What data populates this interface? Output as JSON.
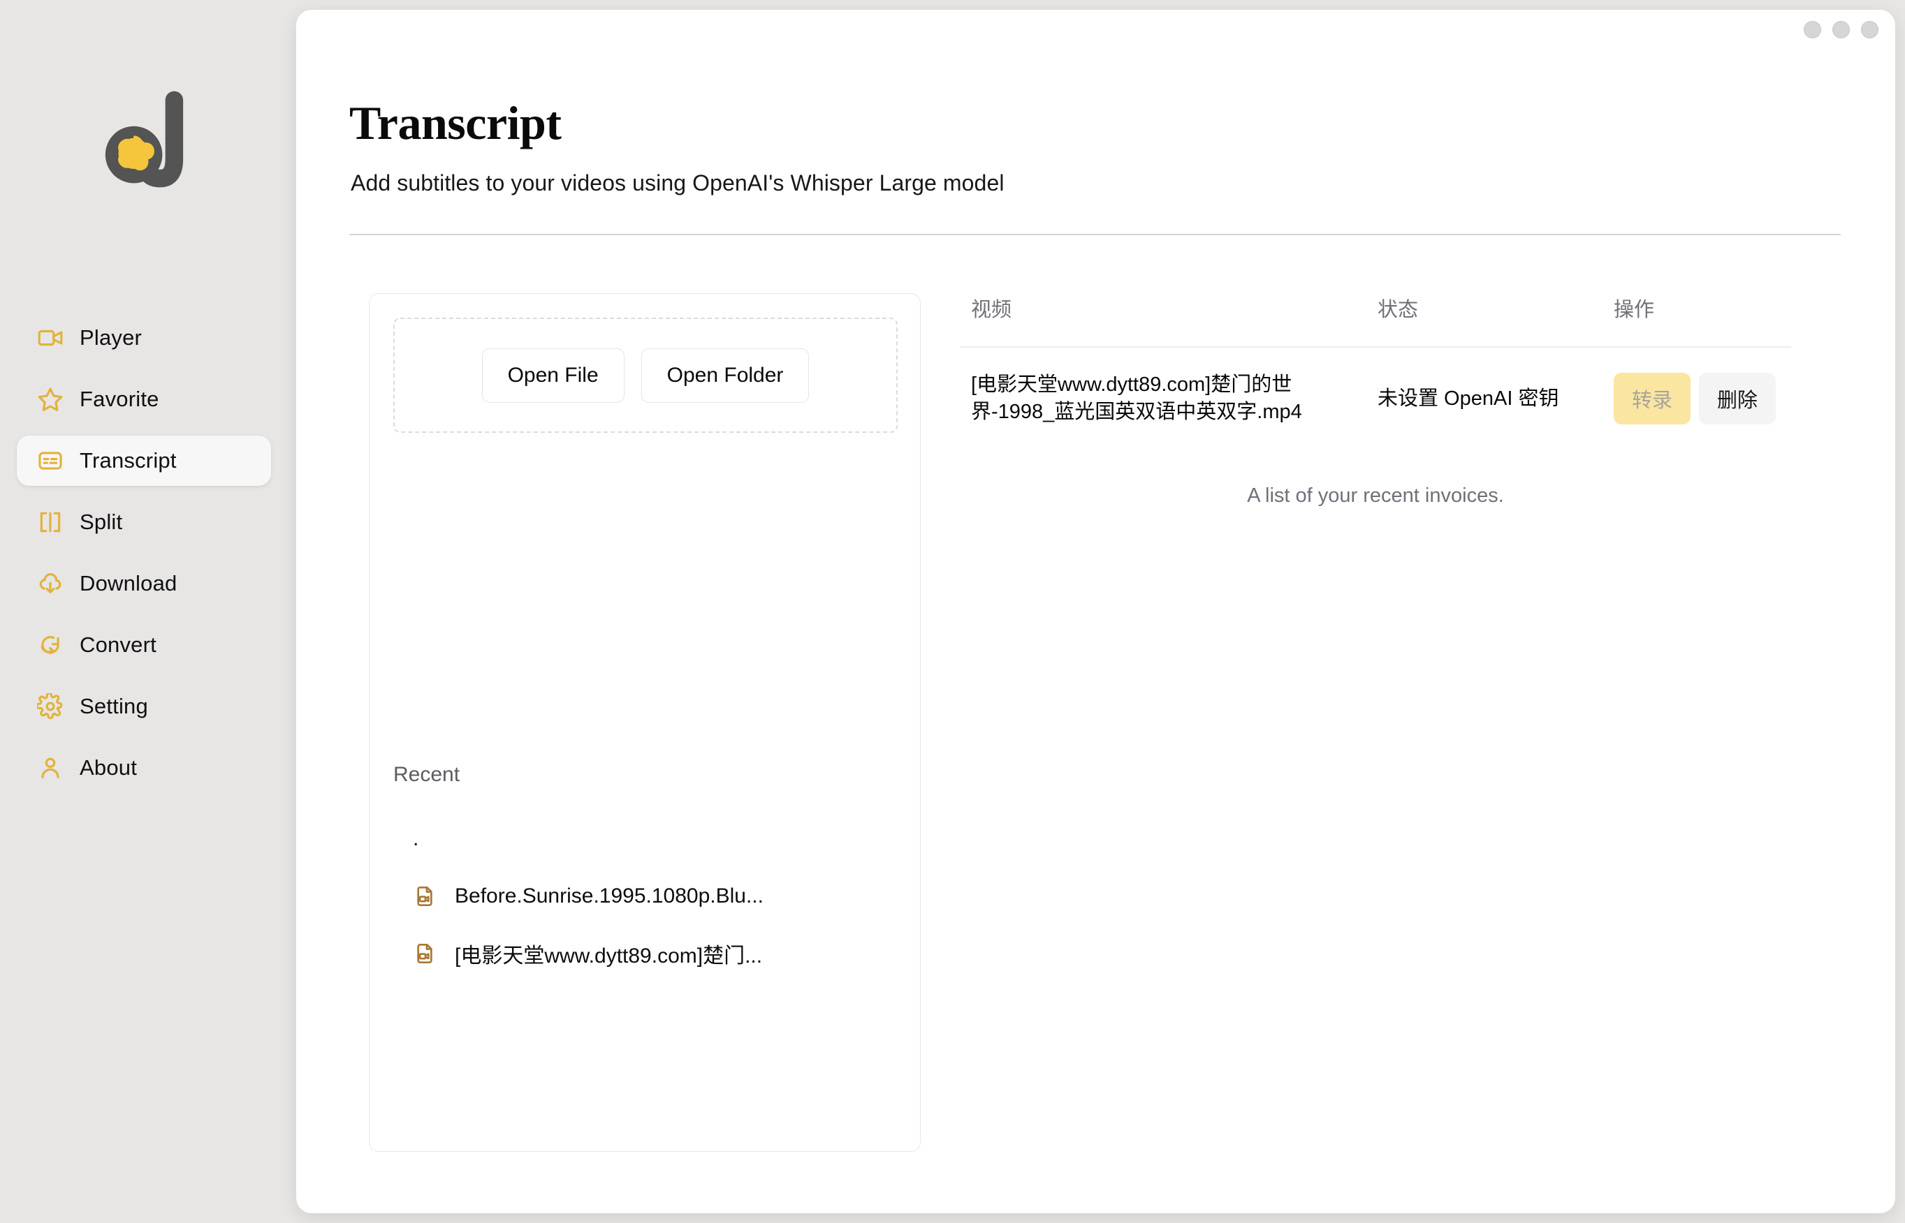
{
  "window": {
    "dots": [
      "minimize-dot",
      "maximize-dot",
      "close-dot"
    ]
  },
  "sidebar": {
    "logo_name": "dinoly-logo",
    "items": [
      {
        "icon": "video-camera-icon",
        "label": "Player",
        "active": false
      },
      {
        "icon": "star-icon",
        "label": "Favorite",
        "active": false
      },
      {
        "icon": "captions-icon",
        "label": "Transcript",
        "active": true
      },
      {
        "icon": "split-icon",
        "label": "Split",
        "active": false
      },
      {
        "icon": "cloud-download-icon",
        "label": "Download",
        "active": false
      },
      {
        "icon": "convert-icon",
        "label": "Convert",
        "active": false
      },
      {
        "icon": "gear-icon",
        "label": "Setting",
        "active": false
      },
      {
        "icon": "user-icon",
        "label": "About",
        "active": false
      }
    ]
  },
  "header": {
    "title": "Transcript",
    "subtitle": "Add subtitles to your videos using OpenAI's Whisper Large model"
  },
  "file_picker": {
    "open_file_label": "Open File",
    "open_folder_label": "Open Folder",
    "recent_label": "Recent",
    "recent_items": [
      {
        "icon": "",
        "name": "."
      },
      {
        "icon": "file-video-icon",
        "name": "Before.Sunrise.1995.1080p.Blu..."
      },
      {
        "icon": "file-video-icon",
        "name": "[电影天堂www.dytt89.com]楚门..."
      }
    ]
  },
  "table": {
    "columns": [
      "视频",
      "状态",
      "操作"
    ],
    "rows": [
      {
        "video": "[电影天堂www.dytt89.com]楚门的世界-1998_蓝光国英双语中英双字.mp4",
        "status": "未设置 OpenAI 密钥",
        "transcribe_label": "转录",
        "delete_label": "删除"
      }
    ],
    "caption": "A list of your recent invoices."
  },
  "colors": {
    "accent": "#e3b23c",
    "primary_button_bg": "#fae5a1",
    "ghost_button_bg": "#f4f4f5",
    "sidebar_bg": "#e7e6e4",
    "panel_bg": "#ffffff",
    "file_icon": "#a87832"
  }
}
